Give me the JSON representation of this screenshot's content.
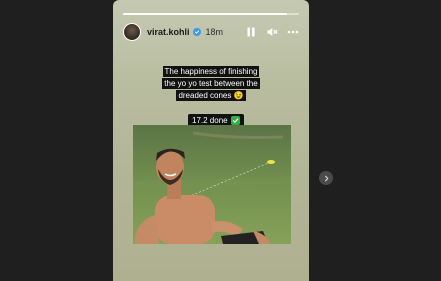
{
  "story": {
    "progress_fraction": 0.93,
    "username": "virat.kohli",
    "time_ago": "18m",
    "verified": true,
    "caption": "The happiness of finishing the yo yo test between the dreaded cones 😉",
    "sticker": "17.2 done",
    "icons": {
      "pause": "pause-icon",
      "mute": "mute-icon",
      "more": "more-icon",
      "check": "checkmark-emoji-icon",
      "next": "chevron-right-icon"
    }
  },
  "colors": {
    "background": "#1f1f20",
    "story_bg": "#b9bd9f",
    "verified": "#3897f0",
    "check": "#2fb344"
  }
}
